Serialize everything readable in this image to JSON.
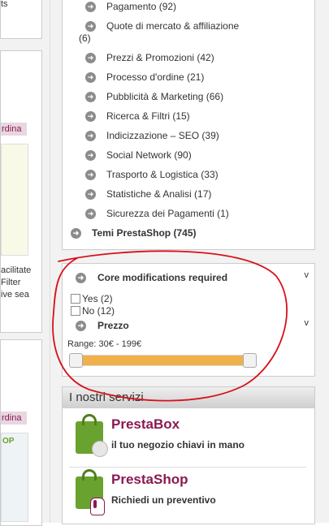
{
  "left_column": {
    "snippet_top": "ts",
    "tag_ordina_1": "rdina",
    "snippet_lines": [
      "acilitate",
      "Filter",
      "ive sea"
    ],
    "tag_ordina_2": "rdina",
    "thumb_text": "OP"
  },
  "categories": {
    "items": [
      {
        "label": "Pagamento (92)"
      },
      {
        "label": "Quote di mercato & affiliazione"
      },
      {
        "label": "Prezzi & Promozioni (42)"
      },
      {
        "label": "Processo d'ordine (21)"
      },
      {
        "label": "Pubblicità & Marketing (66)"
      },
      {
        "label": "Ricerca & Filtri (15)"
      },
      {
        "label": "Indicizzazione – SEO (39)"
      },
      {
        "label": "Social Network (90)"
      },
      {
        "label": "Trasporto & Logistica (33)"
      },
      {
        "label": "Statistiche & Analisi (17)"
      },
      {
        "label": "Sicurezza dei Pagamenti (1)"
      }
    ],
    "wrap_count": "(6)",
    "top_level": "Temi PrestaShop (745)"
  },
  "filters": {
    "core_title": "Core modifications required",
    "toggle": "v",
    "options": [
      {
        "label": "Yes (2)",
        "checked": false
      },
      {
        "label": "No (12)",
        "checked": false
      }
    ],
    "price_title": "Prezzo",
    "range_label": "Range: 30€ - 199€",
    "range_min": 30,
    "range_max": 199
  },
  "services": {
    "header": "I nostri servizi",
    "items": [
      {
        "title": "PrestaBox",
        "subtitle": "il tuo negozio chiavi in mano",
        "icon": "shopping-bag-icon"
      },
      {
        "title": "PrestaShop",
        "subtitle": "Richiedi un preventivo",
        "icon": "shopping-bag-hand-icon"
      }
    ]
  },
  "colors": {
    "accent": "#8a1a52",
    "slider_fill": "#f0b04a",
    "bag_green": "#6aa22f",
    "annotation_red": "#d8101a"
  }
}
